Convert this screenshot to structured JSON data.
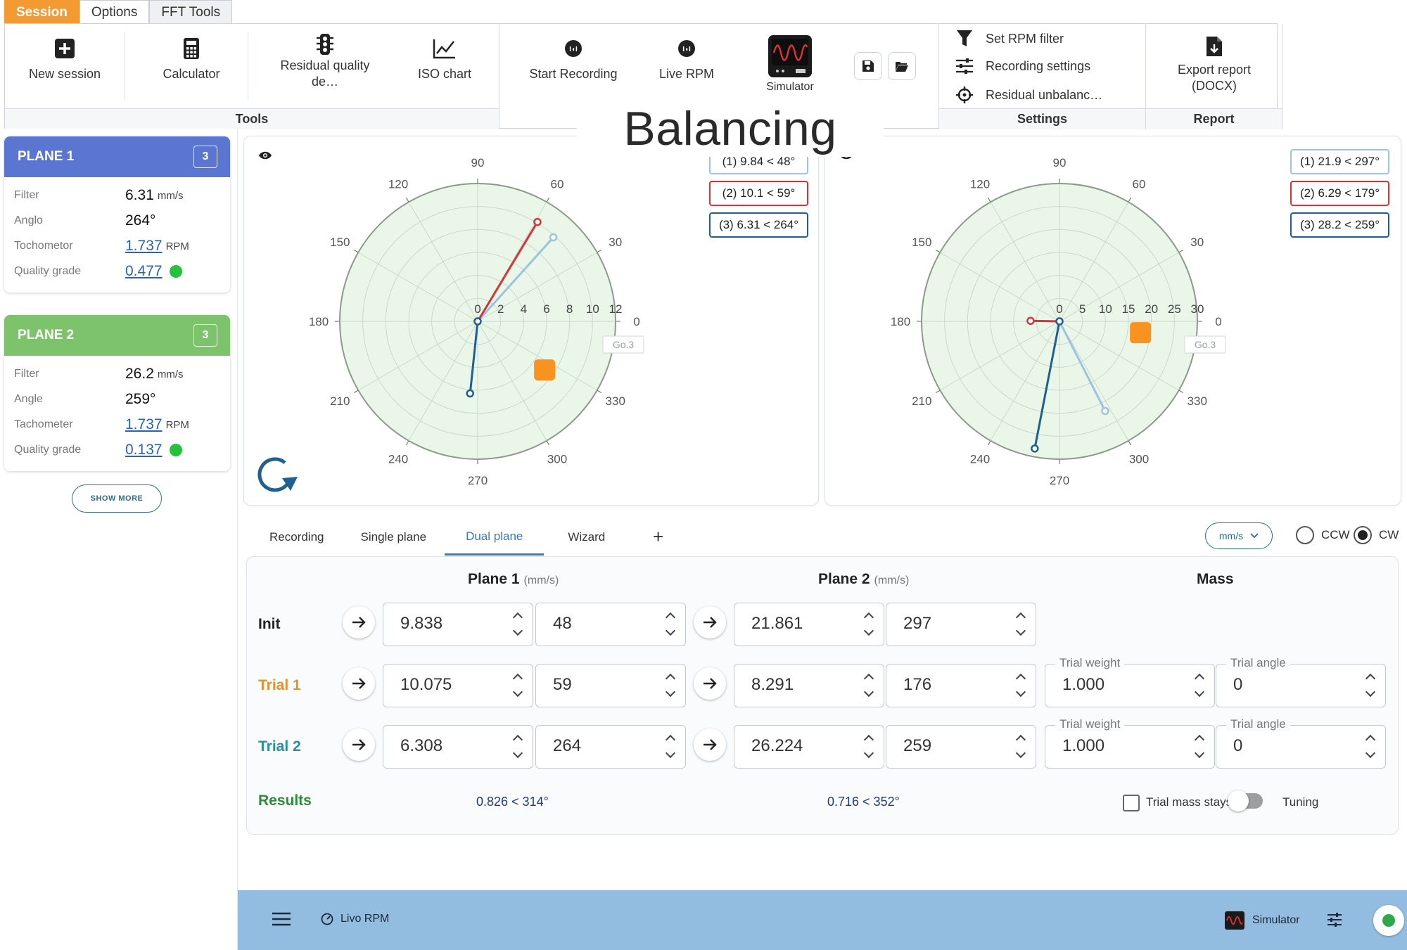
{
  "top_tabs": [
    "Session",
    "Options",
    "FFT Tools"
  ],
  "ribbon": {
    "new_session": "New session",
    "calculator": "Calculator",
    "residual_quality": "Residual quality de…",
    "iso_chart": "ISO chart",
    "start_recording": "Start Recording",
    "live_rpm": "Live RPM",
    "simulator": "Simulator",
    "set_rpm_filter": "Set RPM filter",
    "recording_settings": "Recording settings",
    "residual_unbalance": "Residual unbalanc…",
    "export_report": "Export report (DOCX)",
    "groups": {
      "tools": "Tools",
      "settings": "Settings",
      "report": "Report"
    }
  },
  "overlay_title": "Balancing",
  "planes": [
    {
      "title": "PLANE 1",
      "count": "3",
      "color": "#5b76d1",
      "rows": {
        "filter_label": "Filter",
        "filter_value": "6.31",
        "filter_unit": "mm/s",
        "angle_label": "Anglo",
        "angle_value": "264°",
        "tach_label": "Tochometor",
        "tach_value": "1.737",
        "tach_unit": "RPM",
        "quality_label": "Quality grade",
        "quality_value": "0.477"
      }
    },
    {
      "title": "PLANE 2",
      "count": "3",
      "color": "#7cc36b",
      "rows": {
        "filter_label": "Filter",
        "filter_value": "26.2",
        "filter_unit": "mm/s",
        "angle_label": "Angle",
        "angle_value": "259°",
        "tach_label": "Tachometer",
        "tach_value": "1.737",
        "tach_unit": "RPM",
        "quality_label": "Quality grade",
        "quality_value": "0.137"
      }
    }
  ],
  "show_more": "SHOW MORE",
  "charts": [
    {
      "rmax": 12,
      "ring_labels": [
        "0",
        "2",
        "4",
        "6",
        "8",
        "10",
        "12"
      ],
      "angle_labels": [
        "90",
        "60",
        "30",
        "0",
        "330",
        "300",
        "270",
        "240",
        "210",
        "180",
        "150",
        "120"
      ],
      "tag": "Go.3",
      "legend": [
        "(1) 9.84 < 48°",
        "(2) 10.1 < 59°",
        "(3) 6.31 < 264°"
      ],
      "vectors": [
        {
          "mag": 9.84,
          "angle": 48,
          "color": "#9cc3e0"
        },
        {
          "mag": 10.1,
          "angle": 59,
          "color": "#d4343a"
        },
        {
          "mag": 6.31,
          "angle": 264,
          "color": "#1f5f91"
        }
      ],
      "marker": {
        "mag": 7.2,
        "angle": 324
      }
    },
    {
      "rmax": 30,
      "ring_labels": [
        "0",
        "5",
        "10",
        "15",
        "20",
        "25",
        "30"
      ],
      "angle_labels": [
        "90",
        "60",
        "30",
        "0",
        "330",
        "300",
        "270",
        "240",
        "210",
        "180",
        "150",
        "120"
      ],
      "tag": "Go.3",
      "legend": [
        "(1) 21.9 < 297°",
        "(2) 6.29 < 179°",
        "(3) 28.2 < 259°"
      ],
      "vectors": [
        {
          "mag": 21.9,
          "angle": 297,
          "color": "#9cc3e0"
        },
        {
          "mag": 6.29,
          "angle": 179,
          "color": "#d4343a"
        },
        {
          "mag": 28.2,
          "angle": 259,
          "color": "#1f5f91"
        }
      ],
      "marker": {
        "mag": 17.8,
        "angle": 352
      }
    }
  ],
  "lower_tabs": [
    "Recording",
    "Single plane",
    "Dual plane",
    "Wizard"
  ],
  "unit_select": "mm/s",
  "rotation": {
    "ccw": "CCW",
    "cw": "CW",
    "selected": "CW"
  },
  "calc": {
    "plane1_header": "Plane 1",
    "plane2_header": "Plane 2",
    "unit": "(mm/s)",
    "mass_header": "Mass",
    "init_label": "Init",
    "trial1_label": "Trial 1",
    "trial2_label": "Trial 2",
    "results_label": "Results",
    "init": {
      "p1_mag": "9.838",
      "p1_ang": "48",
      "p2_mag": "21.861",
      "p2_ang": "297"
    },
    "trial1": {
      "p1_mag": "10.075",
      "p1_ang": "59",
      "p2_mag": "8.291",
      "p2_ang": "176",
      "weight": "1.000",
      "angle": "0"
    },
    "trial2": {
      "p1_mag": "6.308",
      "p1_ang": "264",
      "p2_mag": "26.224",
      "p2_ang": "259",
      "weight": "1.000",
      "angle": "0"
    },
    "trial_weight_label": "Trial weight",
    "trial_angle_label": "Trial angle",
    "result_p1": "0.826 < 314°",
    "result_p2": "0.716 < 352°",
    "trial_mass_stays": "Trial mass stays",
    "tuning": "Tuning"
  },
  "bottom": {
    "live_rpm": "Livo RPM",
    "simulator": "Simulator"
  },
  "colors": {
    "accent_orange": "#f39a33",
    "trial1": "#e0922e",
    "trial2": "#2a8f9a",
    "results": "#2e8b3a"
  }
}
